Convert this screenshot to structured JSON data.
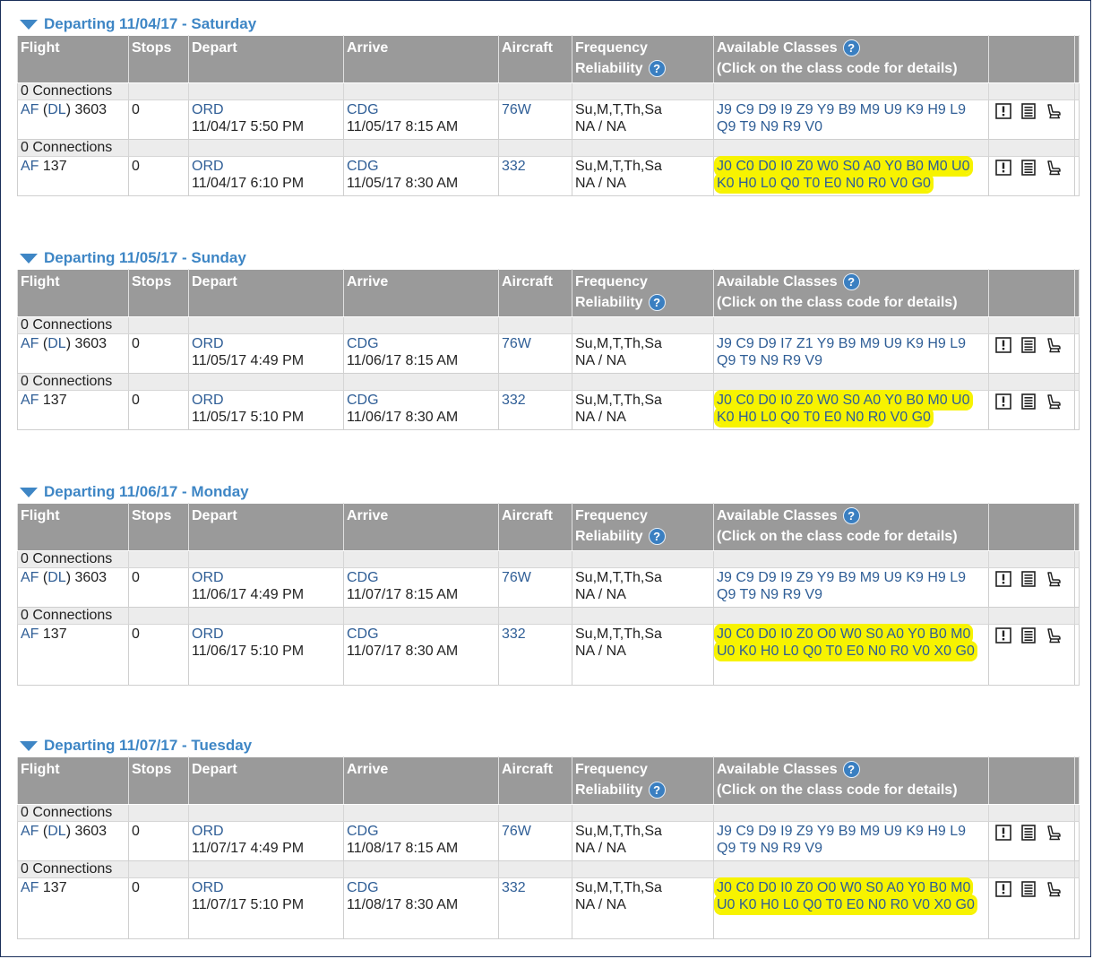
{
  "headers": {
    "flight": "Flight",
    "stops": "Stops",
    "depart": "Depart",
    "arrive": "Arrive",
    "aircraft": "Aircraft",
    "frequency": "Frequency",
    "reliability": "Reliability",
    "available_classes": "Available Classes",
    "classes_hint": "(Click on the class code for details)",
    "help_glyph": "?"
  },
  "icon_names": [
    "alert-icon",
    "details-icon",
    "seat-map-icon"
  ],
  "colors": {
    "link": "#2f5e96",
    "day_title": "#3e86c5",
    "header_bg": "#9a9a9a",
    "highlight": "#f7f300"
  },
  "days": [
    {
      "title": "Departing 11/04/17 - Saturday",
      "flights": [
        {
          "connections": "0 Connections",
          "airline": "AF",
          "codeshare": "DL",
          "number": "3603",
          "stops": "0",
          "depart_airport": "ORD",
          "depart_time": "11/04/17 5:50 PM",
          "arrive_airport": "CDG",
          "arrive_time": "11/05/17 8:15 AM",
          "aircraft": "76W",
          "frequency": "Su,M,T,Th,Sa",
          "reliability": "NA / NA",
          "classes_line1": "J9 C9 D9 I9 Z9 Y9 B9 M9 U9 K9 H9 L9",
          "classes_line2": "Q9 T9 N9 R9 V0",
          "highlighted": false
        },
        {
          "connections": "0 Connections",
          "airline": "AF",
          "codeshare": "",
          "number": "137",
          "stops": "0",
          "depart_airport": "ORD",
          "depart_time": "11/04/17 6:10 PM",
          "arrive_airport": "CDG",
          "arrive_time": "11/05/17 8:30 AM",
          "aircraft": "332",
          "frequency": "Su,M,T,Th,Sa",
          "reliability": "NA / NA",
          "classes_line1": "J0 C0 D0 I0 Z0 W0 S0 A0 Y0 B0 M0 U0",
          "classes_line2": "K0 H0 L0 Q0 T0 E0 N0 R0 V0 G0",
          "highlighted": true
        }
      ]
    },
    {
      "title": "Departing 11/05/17 - Sunday",
      "flights": [
        {
          "connections": "0 Connections",
          "airline": "AF",
          "codeshare": "DL",
          "number": "3603",
          "stops": "0",
          "depart_airport": "ORD",
          "depart_time": "11/05/17 4:49 PM",
          "arrive_airport": "CDG",
          "arrive_time": "11/06/17 8:15 AM",
          "aircraft": "76W",
          "frequency": "Su,M,T,Th,Sa",
          "reliability": "NA / NA",
          "classes_line1": "J9 C9 D9 I7 Z1 Y9 B9 M9 U9 K9 H9 L9",
          "classes_line2": "Q9 T9 N9 R9 V9",
          "highlighted": false
        },
        {
          "connections": "0 Connections",
          "airline": "AF",
          "codeshare": "",
          "number": "137",
          "stops": "0",
          "depart_airport": "ORD",
          "depart_time": "11/05/17 5:10 PM",
          "arrive_airport": "CDG",
          "arrive_time": "11/06/17 8:30 AM",
          "aircraft": "332",
          "frequency": "Su,M,T,Th,Sa",
          "reliability": "NA / NA",
          "classes_line1": "J0 C0 D0 I0 Z0 W0 S0 A0 Y0 B0 M0 U0",
          "classes_line2": "K0 H0 L0 Q0 T0 E0 N0 R0 V0 G0",
          "highlighted": true
        }
      ]
    },
    {
      "title": "Departing 11/06/17 - Monday",
      "flights": [
        {
          "connections": "0 Connections",
          "airline": "AF",
          "codeshare": "DL",
          "number": "3603",
          "stops": "0",
          "depart_airport": "ORD",
          "depart_time": "11/06/17 4:49 PM",
          "arrive_airport": "CDG",
          "arrive_time": "11/07/17 8:15 AM",
          "aircraft": "76W",
          "frequency": "Su,M,T,Th,Sa",
          "reliability": "NA / NA",
          "classes_line1": "J9 C9 D9 I9 Z9 Y9 B9 M9 U9 K9 H9 L9",
          "classes_line2": "Q9 T9 N9 R9 V9",
          "highlighted": false
        },
        {
          "connections": "0 Connections",
          "airline": "AF",
          "codeshare": "",
          "number": "137",
          "stops": "0",
          "depart_airport": "ORD",
          "depart_time": "11/06/17 5:10 PM",
          "arrive_airport": "CDG",
          "arrive_time": "11/07/17 8:30 AM",
          "aircraft": "332",
          "frequency": "Su,M,T,Th,Sa",
          "reliability": "NA / NA",
          "classes_line1": "J0 C0 D0 I0 Z0 O0 W0 S0 A0 Y0 B0 M0",
          "classes_line2": "U0 K0 H0 L0 Q0 T0 E0 N0 R0 V0 X0 G0",
          "highlighted": true
        }
      ]
    },
    {
      "title": "Departing 11/07/17 - Tuesday",
      "flights": [
        {
          "connections": "0 Connections",
          "airline": "AF",
          "codeshare": "DL",
          "number": "3603",
          "stops": "0",
          "depart_airport": "ORD",
          "depart_time": "11/07/17 4:49 PM",
          "arrive_airport": "CDG",
          "arrive_time": "11/08/17 8:15 AM",
          "aircraft": "76W",
          "frequency": "Su,M,T,Th,Sa",
          "reliability": "NA / NA",
          "classes_line1": "J9 C9 D9 I9 Z9 Y9 B9 M9 U9 K9 H9 L9",
          "classes_line2": "Q9 T9 N9 R9 V9",
          "highlighted": false
        },
        {
          "connections": "0 Connections",
          "airline": "AF",
          "codeshare": "",
          "number": "137",
          "stops": "0",
          "depart_airport": "ORD",
          "depart_time": "11/07/17 5:10 PM",
          "arrive_airport": "CDG",
          "arrive_time": "11/08/17 8:30 AM",
          "aircraft": "332",
          "frequency": "Su,M,T,Th,Sa",
          "reliability": "NA / NA",
          "classes_line1": "J0 C0 D0 I0 Z0 O0 W0 S0 A0 Y0 B0 M0",
          "classes_line2": "U0 K0 H0 L0 Q0 T0 E0 N0 R0 V0 X0 G0",
          "highlighted": true
        }
      ]
    }
  ]
}
